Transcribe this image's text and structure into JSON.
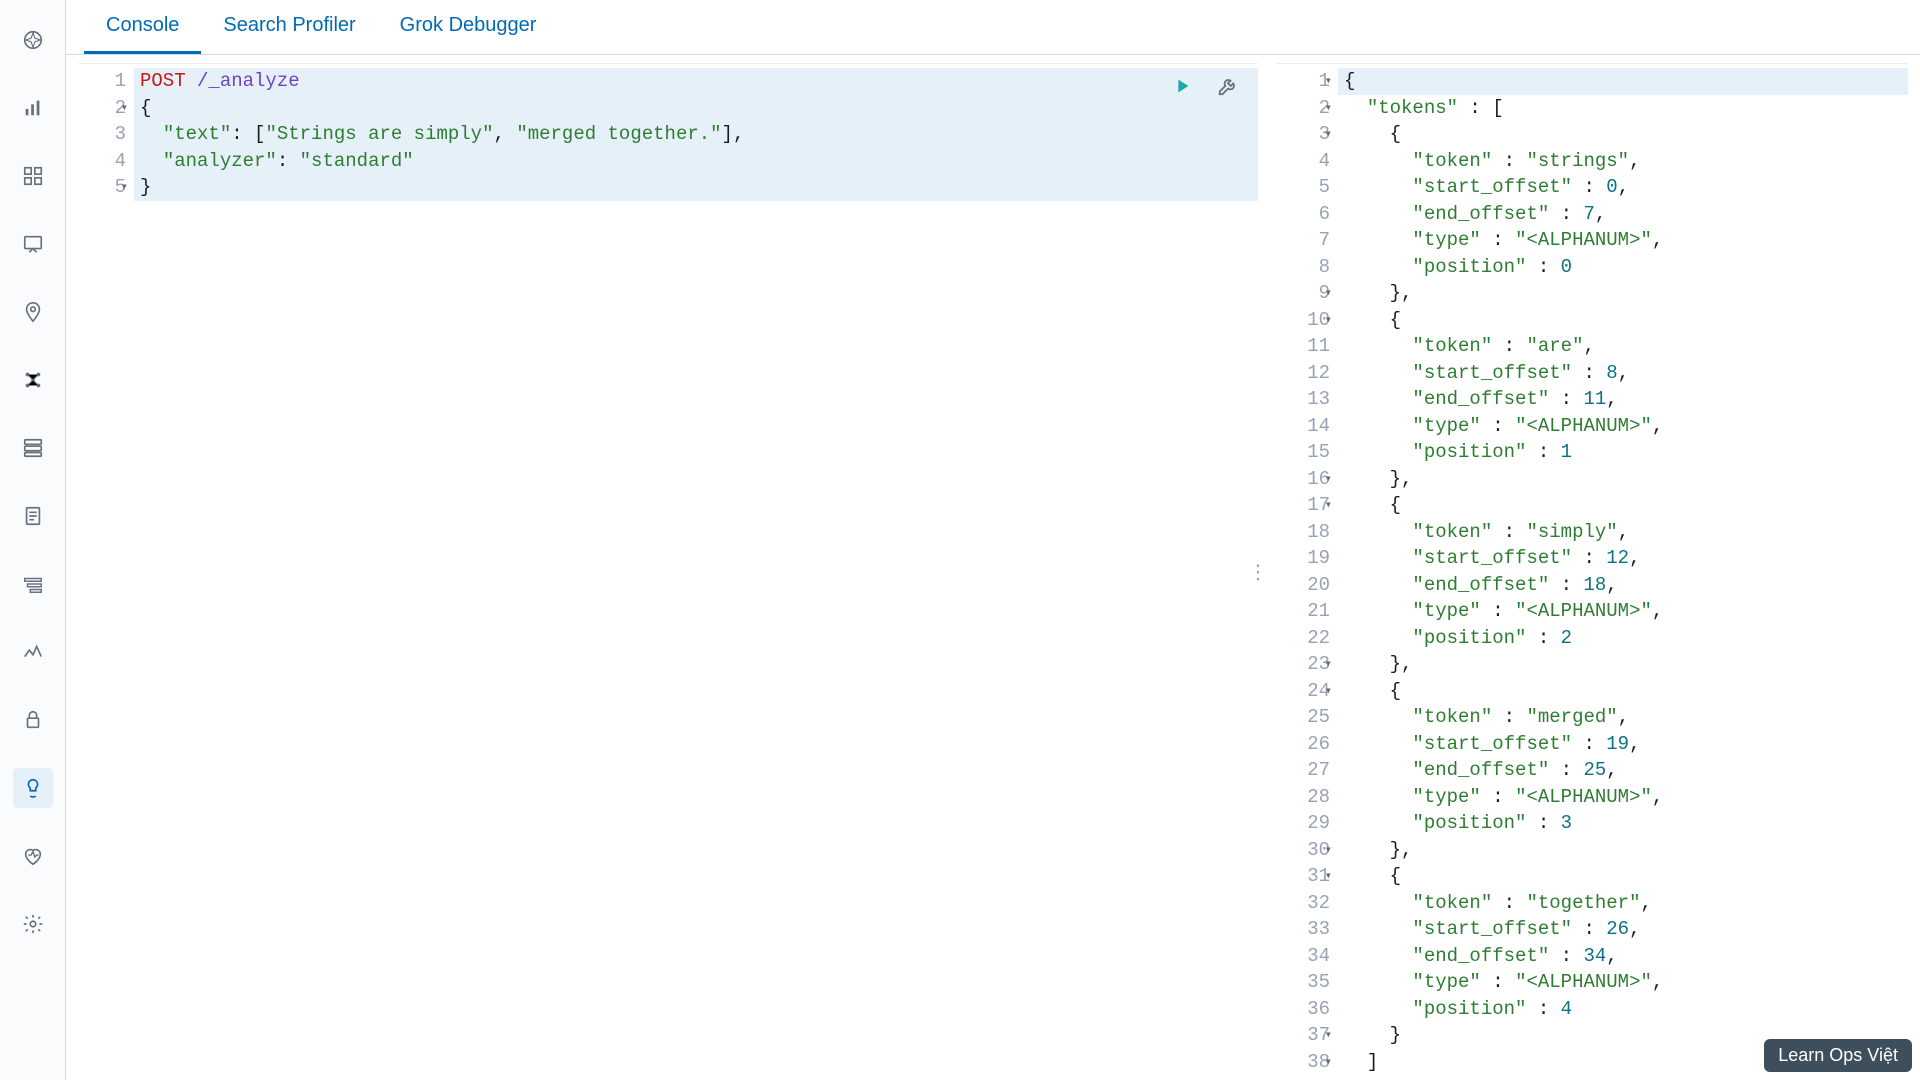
{
  "sidebar": {
    "items": [
      {
        "name": "discover-icon"
      },
      {
        "name": "visualize-icon"
      },
      {
        "name": "dashboard-icon"
      },
      {
        "name": "canvas-icon"
      },
      {
        "name": "maps-icon"
      },
      {
        "name": "ml-icon"
      },
      {
        "name": "infrastructure-icon"
      },
      {
        "name": "logs-icon"
      },
      {
        "name": "apm-icon"
      },
      {
        "name": "uptime-icon"
      },
      {
        "name": "security-icon"
      },
      {
        "name": "devtools-icon"
      },
      {
        "name": "monitoring-icon"
      },
      {
        "name": "management-icon"
      }
    ],
    "active_index": 11
  },
  "tabs": {
    "items": [
      "Console",
      "Search Profiler",
      "Grok Debugger"
    ],
    "active_index": 0
  },
  "request": {
    "method": "POST",
    "path": "/_analyze",
    "body_lines": [
      {
        "n": 1,
        "method": true
      },
      {
        "n": 2,
        "fold": true,
        "text": "{"
      },
      {
        "n": 3,
        "key": "text",
        "val_raw": "[\"Strings are simply\", \"merged together.\"]",
        "comma": true
      },
      {
        "n": 4,
        "key": "analyzer",
        "val": "standard"
      },
      {
        "n": 5,
        "fold": true,
        "text": "}"
      }
    ]
  },
  "response": {
    "lines": [
      {
        "n": 1,
        "fold": true,
        "depth": 0,
        "text": "{"
      },
      {
        "n": 2,
        "fold": true,
        "depth": 1,
        "key": "tokens",
        "after": " : ["
      },
      {
        "n": 3,
        "fold": true,
        "depth": 2,
        "text": "{"
      },
      {
        "n": 4,
        "depth": 3,
        "key": "token",
        "val": "strings",
        "comma": true
      },
      {
        "n": 5,
        "depth": 3,
        "key": "start_offset",
        "num": 0,
        "comma": true
      },
      {
        "n": 6,
        "depth": 3,
        "key": "end_offset",
        "num": 7,
        "comma": true
      },
      {
        "n": 7,
        "depth": 3,
        "key": "type",
        "val": "<ALPHANUM>",
        "comma": true
      },
      {
        "n": 8,
        "depth": 3,
        "key": "position",
        "num": 0
      },
      {
        "n": 9,
        "fold": true,
        "depth": 2,
        "text": "},"
      },
      {
        "n": 10,
        "fold": true,
        "depth": 2,
        "text": "{"
      },
      {
        "n": 11,
        "depth": 3,
        "key": "token",
        "val": "are",
        "comma": true
      },
      {
        "n": 12,
        "depth": 3,
        "key": "start_offset",
        "num": 8,
        "comma": true
      },
      {
        "n": 13,
        "depth": 3,
        "key": "end_offset",
        "num": 11,
        "comma": true
      },
      {
        "n": 14,
        "depth": 3,
        "key": "type",
        "val": "<ALPHANUM>",
        "comma": true
      },
      {
        "n": 15,
        "depth": 3,
        "key": "position",
        "num": 1
      },
      {
        "n": 16,
        "fold": true,
        "depth": 2,
        "text": "},"
      },
      {
        "n": 17,
        "fold": true,
        "depth": 2,
        "text": "{"
      },
      {
        "n": 18,
        "depth": 3,
        "key": "token",
        "val": "simply",
        "comma": true
      },
      {
        "n": 19,
        "depth": 3,
        "key": "start_offset",
        "num": 12,
        "comma": true
      },
      {
        "n": 20,
        "depth": 3,
        "key": "end_offset",
        "num": 18,
        "comma": true
      },
      {
        "n": 21,
        "depth": 3,
        "key": "type",
        "val": "<ALPHANUM>",
        "comma": true
      },
      {
        "n": 22,
        "depth": 3,
        "key": "position",
        "num": 2
      },
      {
        "n": 23,
        "fold": true,
        "depth": 2,
        "text": "},"
      },
      {
        "n": 24,
        "fold": true,
        "depth": 2,
        "text": "{"
      },
      {
        "n": 25,
        "depth": 3,
        "key": "token",
        "val": "merged",
        "comma": true
      },
      {
        "n": 26,
        "depth": 3,
        "key": "start_offset",
        "num": 19,
        "comma": true
      },
      {
        "n": 27,
        "depth": 3,
        "key": "end_offset",
        "num": 25,
        "comma": true
      },
      {
        "n": 28,
        "depth": 3,
        "key": "type",
        "val": "<ALPHANUM>",
        "comma": true
      },
      {
        "n": 29,
        "depth": 3,
        "key": "position",
        "num": 3
      },
      {
        "n": 30,
        "fold": true,
        "depth": 2,
        "text": "},"
      },
      {
        "n": 31,
        "fold": true,
        "depth": 2,
        "text": "{"
      },
      {
        "n": 32,
        "depth": 3,
        "key": "token",
        "val": "together",
        "comma": true
      },
      {
        "n": 33,
        "depth": 3,
        "key": "start_offset",
        "num": 26,
        "comma": true
      },
      {
        "n": 34,
        "depth": 3,
        "key": "end_offset",
        "num": 34,
        "comma": true
      },
      {
        "n": 35,
        "depth": 3,
        "key": "type",
        "val": "<ALPHANUM>",
        "comma": true
      },
      {
        "n": 36,
        "depth": 3,
        "key": "position",
        "num": 4
      },
      {
        "n": 37,
        "fold": true,
        "depth": 2,
        "text": "}"
      },
      {
        "n": 38,
        "fold": true,
        "depth": 1,
        "text": "]"
      }
    ]
  },
  "watermark": "Learn Ops Việt"
}
